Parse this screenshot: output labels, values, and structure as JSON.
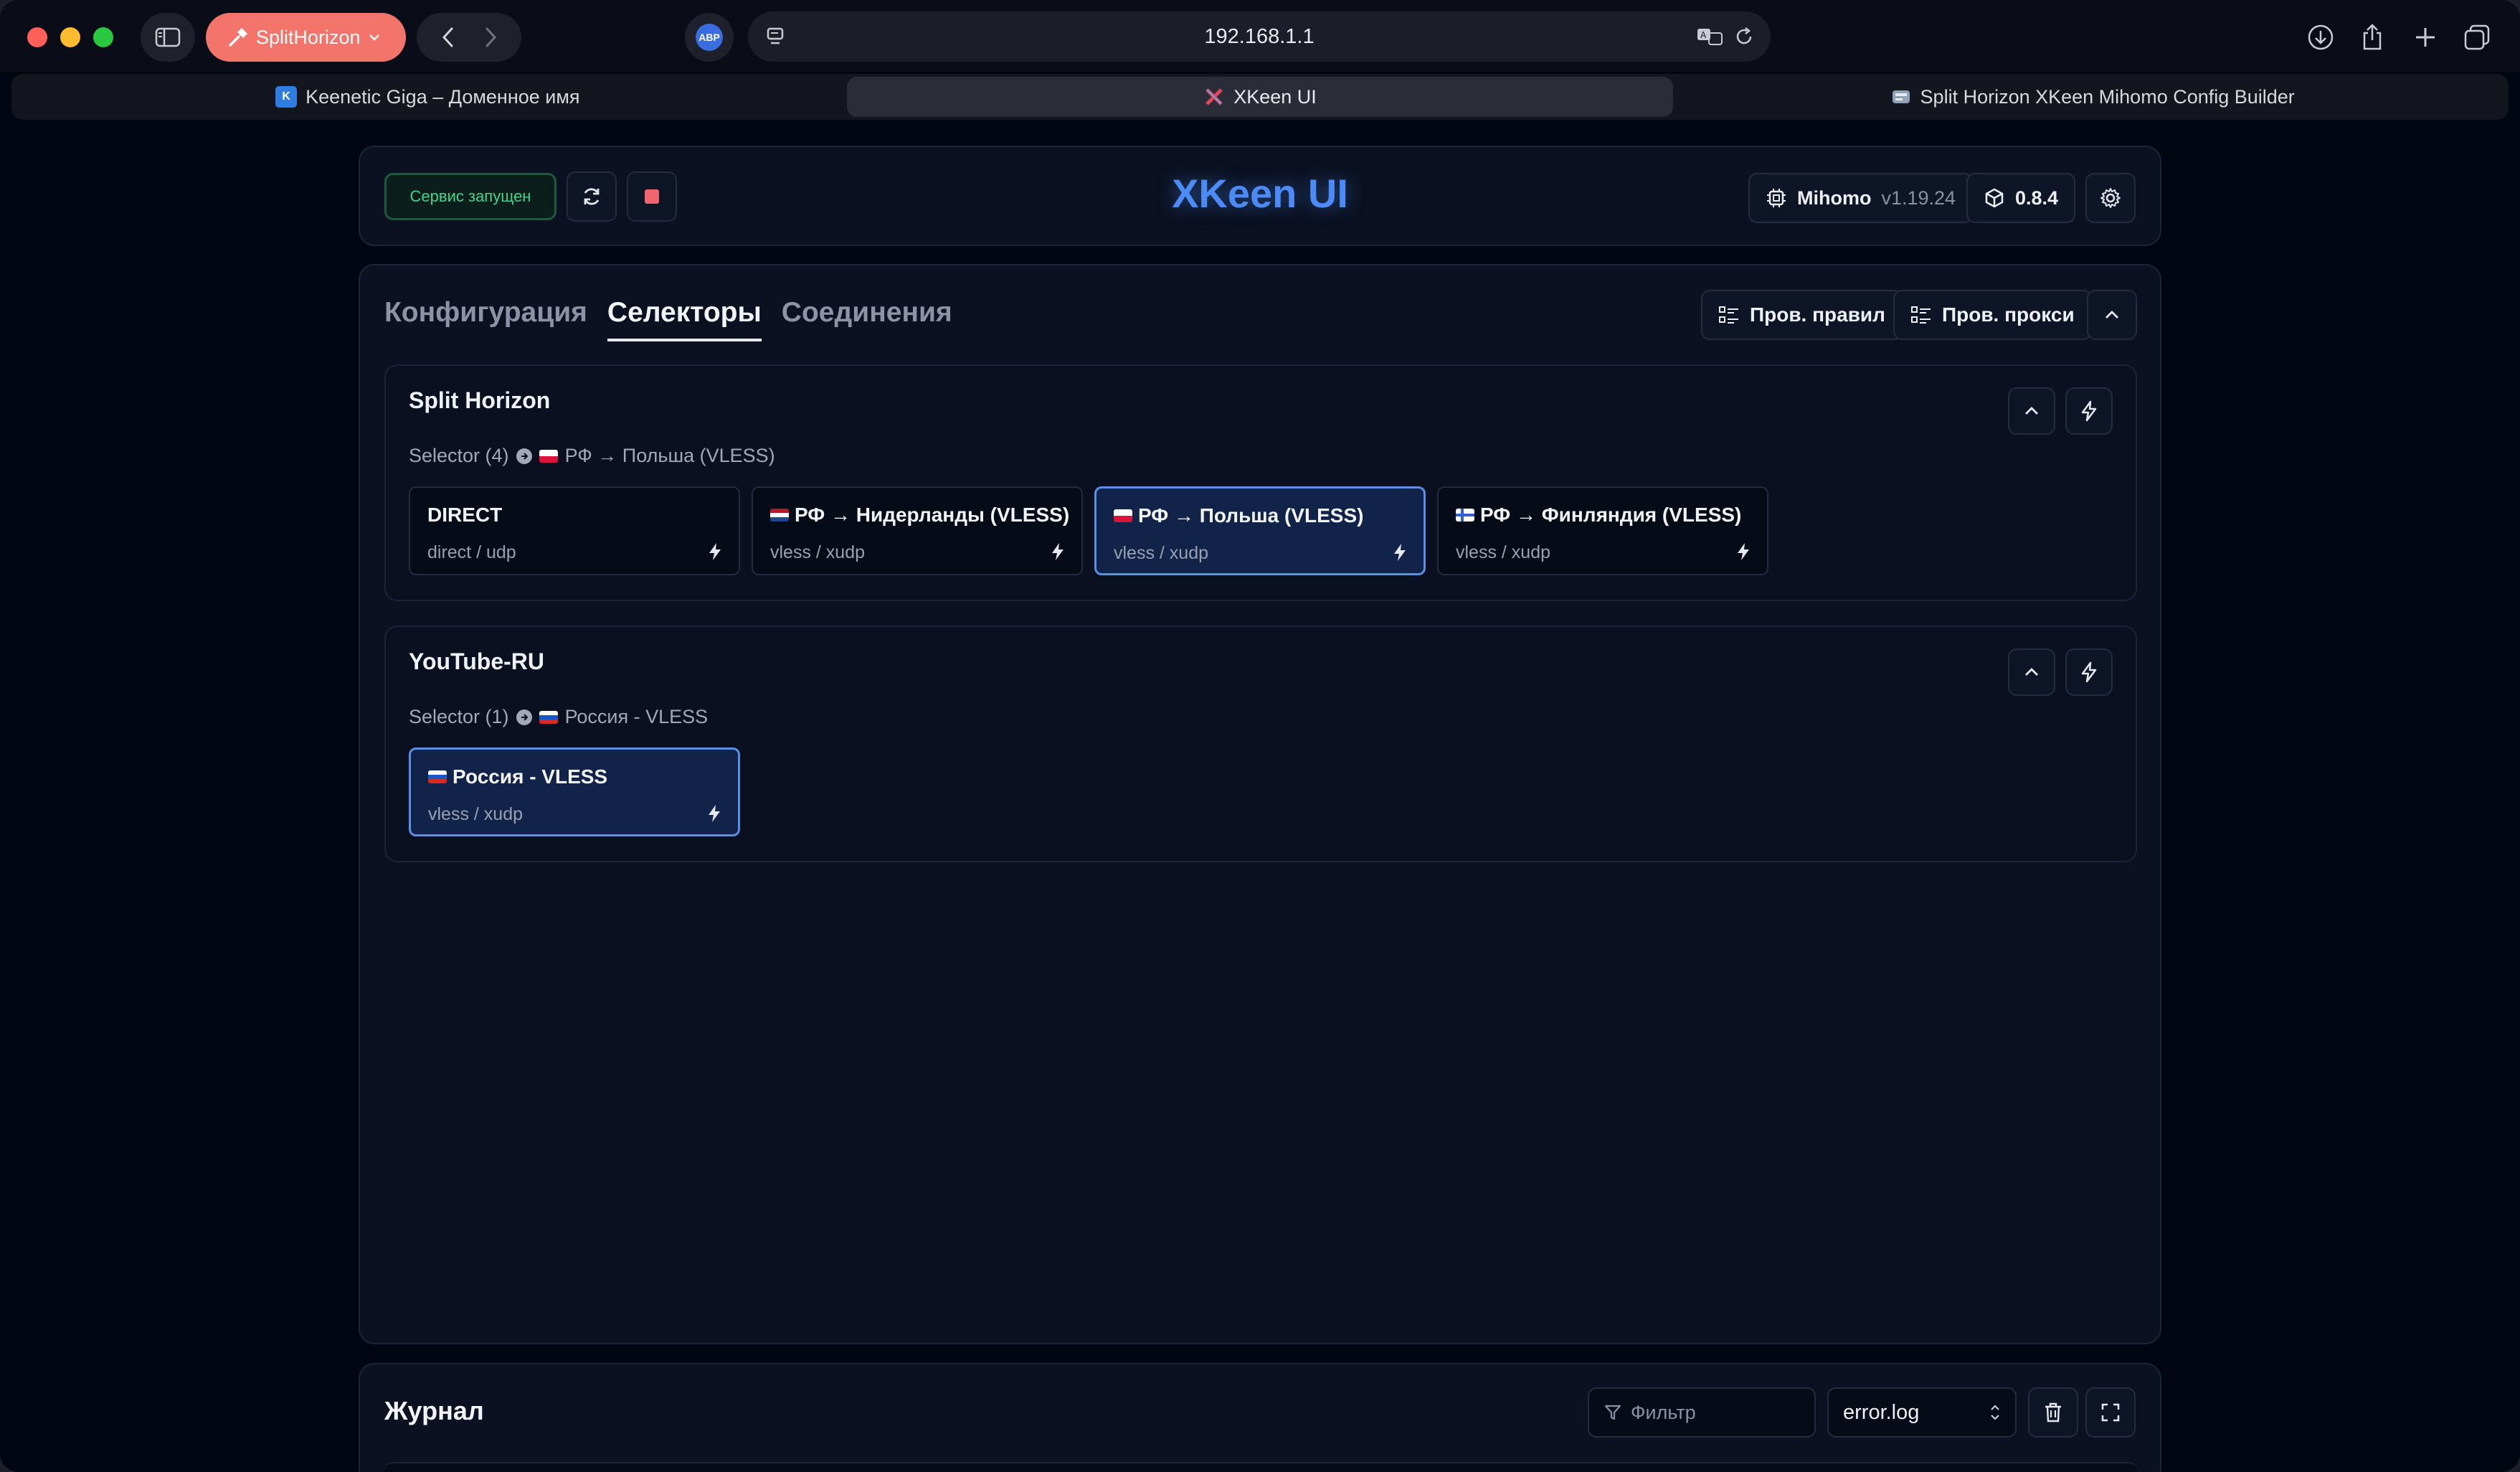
{
  "browser": {
    "profile": "SplitHorizon",
    "url": "192.168.1.1",
    "abp_label": "ABP",
    "tabs": [
      {
        "title": "Keenetic Giga – Доменное имя",
        "active": false
      },
      {
        "title": "XKeen UI",
        "active": true
      },
      {
        "title": "Split Horizon XKeen Mihomo Config Builder",
        "active": false
      }
    ]
  },
  "header": {
    "status": "Сервис запущен",
    "title": "XKeen UI",
    "core_name": "Mihomo",
    "core_version": "v1.19.24",
    "app_version": "0.8.4"
  },
  "main": {
    "tabs": [
      "Конфигурация",
      "Селекторы",
      "Соединения"
    ],
    "active_tab": "Селекторы",
    "check_rules": "Пров. правил",
    "check_proxies": "Пров. прокси",
    "groups": [
      {
        "name": "Split Horizon",
        "summary": "Selector (4)",
        "current": "РФ → Польша (VLESS)",
        "current_flag": "pl",
        "proxies": [
          {
            "name": "DIRECT",
            "type": "direct / udp",
            "flag": "",
            "selected": false
          },
          {
            "name": "РФ → Нидерланды (VLESS)",
            "type": "vless / xudp",
            "flag": "nl",
            "selected": false
          },
          {
            "name": "РФ → Польша (VLESS)",
            "type": "vless / xudp",
            "flag": "pl",
            "selected": true
          },
          {
            "name": "РФ → Финляндия (VLESS)",
            "type": "vless / xudp",
            "flag": "fi",
            "selected": false
          }
        ]
      },
      {
        "name": "YouTube-RU",
        "summary": "Selector (1)",
        "current": "Россия - VLESS",
        "current_flag": "ru",
        "proxies": [
          {
            "name": "Россия - VLESS",
            "type": "vless / xudp",
            "flag": "ru",
            "selected": true
          }
        ]
      }
    ]
  },
  "log": {
    "title": "Журнал",
    "filter_placeholder": "Фильтр",
    "file": "error.log"
  },
  "colors": {
    "accent": "#4c8bf5",
    "status_green": "#3dd68c",
    "stop_red": "#f06470",
    "profile": "#f2746a"
  }
}
